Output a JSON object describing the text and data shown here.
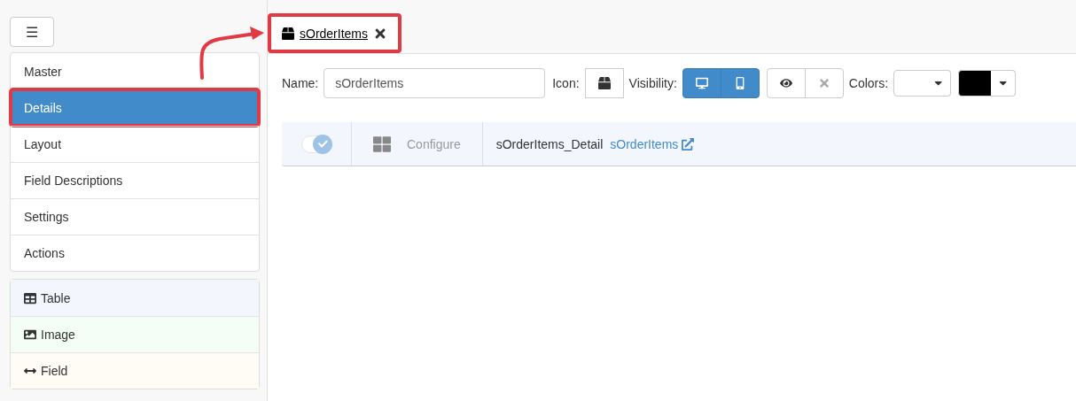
{
  "menu_button": {
    "label": "☰"
  },
  "sidebar": {
    "items": [
      {
        "label": "Master",
        "selected": false,
        "highlighted": false
      },
      {
        "label": "Details",
        "selected": true,
        "highlighted": true
      },
      {
        "label": "Layout",
        "selected": false,
        "highlighted": false
      },
      {
        "label": "Field Descriptions",
        "selected": false,
        "highlighted": false
      },
      {
        "label": "Settings",
        "selected": false,
        "highlighted": false
      },
      {
        "label": "Actions",
        "selected": false,
        "highlighted": false
      }
    ]
  },
  "palette": [
    {
      "kind": "table",
      "label": "Table",
      "color": "#f3f6fd"
    },
    {
      "kind": "image",
      "label": "Image",
      "color": "#f4fdf6"
    },
    {
      "kind": "field",
      "label": "Field",
      "color": "#fefcf4"
    }
  ],
  "tabs": [
    {
      "label": "sOrderItems",
      "highlighted": true
    }
  ],
  "annotation_arrow": true,
  "toolbar": {
    "name_label": "Name:",
    "name_value": "sOrderItems",
    "icon_label": "Icon:",
    "visibility_label": "Visibility:",
    "desktop_visible": true,
    "mobile_visible": true,
    "hidden": false,
    "colors_label": "Colors:",
    "color_pickers": [
      {
        "color": "#ffffff"
      },
      {
        "color": "#000000"
      }
    ]
  },
  "detail_row": {
    "enabled": true,
    "configure": "Configure",
    "name": "sOrderItems_Detail",
    "link": "sOrderItems"
  }
}
